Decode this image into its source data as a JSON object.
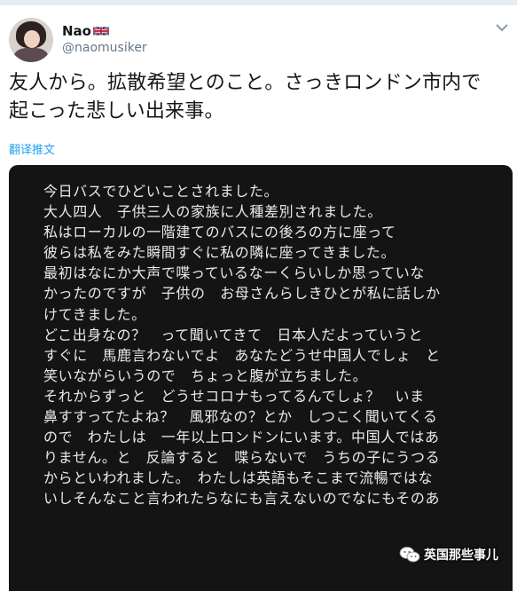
{
  "tweet": {
    "display_name": "Nao",
    "handle": "@naomusiker",
    "flag_icon": "uk-flag-icon",
    "text": "友人から。拡散希望とのこと。さっきロンドン市内で\n起こった悲しい出来事。",
    "translate_label": "翻译推文"
  },
  "image": {
    "lines": [
      "今日バスでひどいことされました。",
      "大人四人　子供三人の家族に人種差別されました。",
      "私はローカルの一階建てのバスにの後ろの方に座って",
      "彼らは私をみた瞬間すぐに私の隣に座ってきました。",
      "最初はなにか大声で喋っているなーくらいしか思っていな",
      "かったのですが　子供の　お母さんらしきひとが私に話しか",
      "けてきました。",
      "どこ出身なの？　って聞いてきて　日本人だよっていうと",
      "すぐに　馬鹿言わないでよ　あなたどうせ中国人でしょ　と",
      "笑いながらいうので　ちょっと腹が立ちました。",
      "それからずっと　どうせコロナもってるんでしょ？　いま",
      "鼻すすってたよね？　風邪なの？とか　しつこく聞いてくる",
      "ので　わたしは　一年以上ロンドンにいます。中国人ではあ",
      "りません。と　反論すると　喋らないで　うちの子にうつる",
      "からといわれました。　わたしは英語もそこまで流暢ではな",
      "いしそんなこと言われたらなにも言えないのでなにもそのあ"
    ]
  },
  "watermark": {
    "text": "英国那些事儿",
    "icon": "wechat-icon"
  },
  "colors": {
    "accent": "#1da1f2",
    "text": "#14171a",
    "muted": "#657786",
    "image_bg": "#141414"
  }
}
